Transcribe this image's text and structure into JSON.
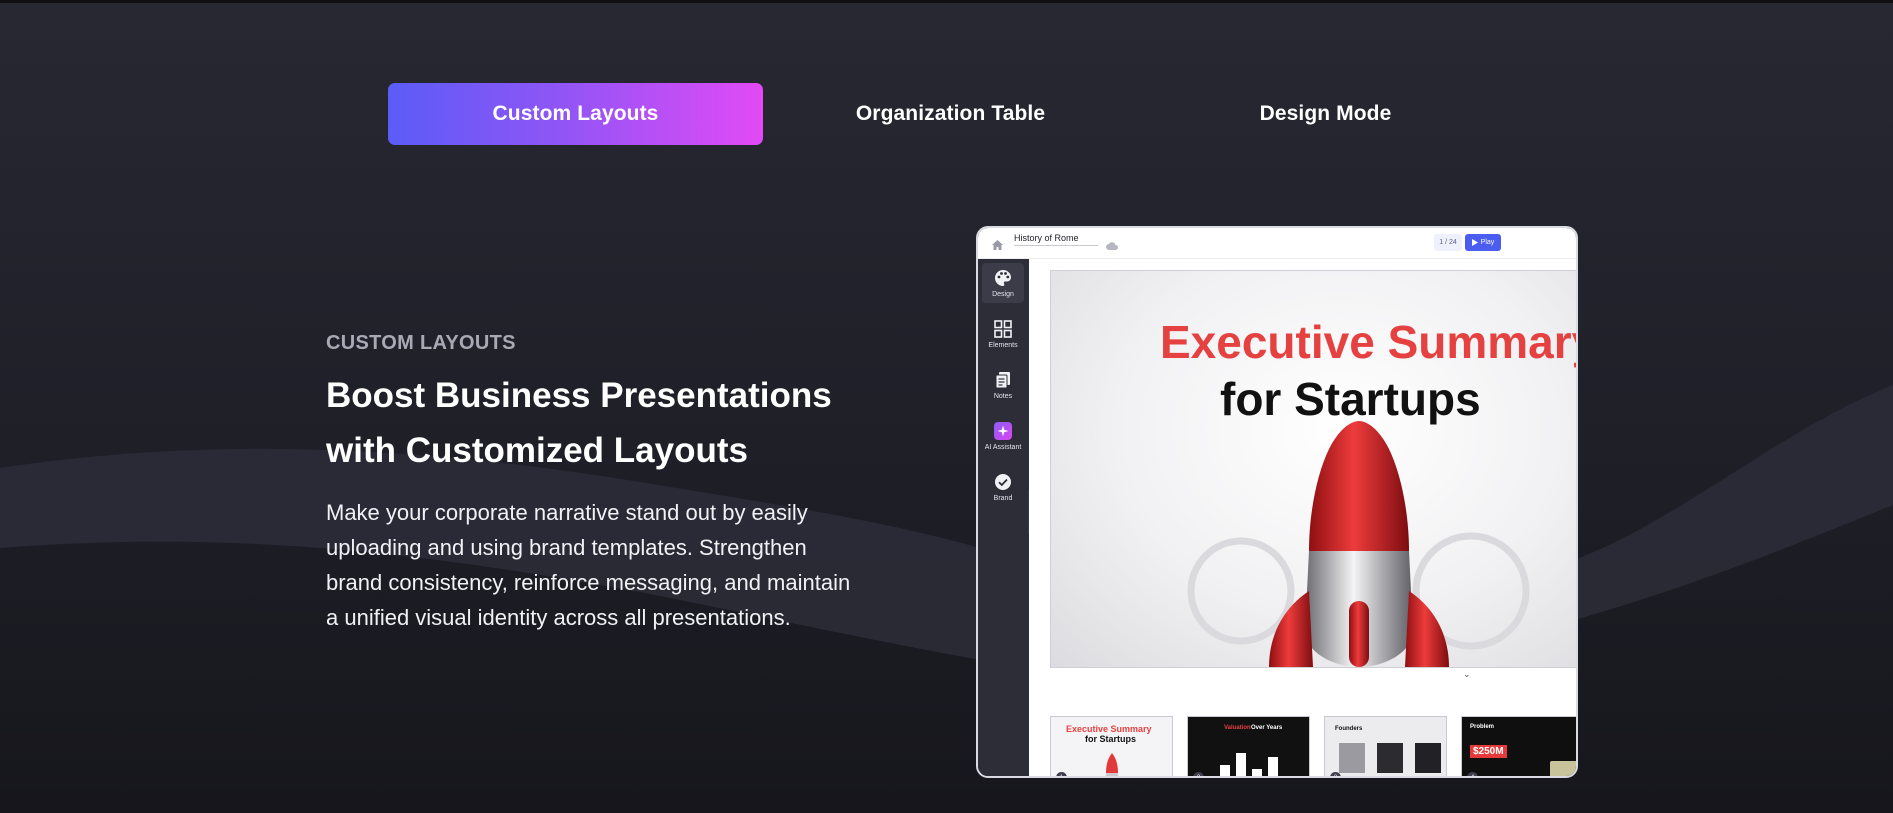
{
  "tabs": [
    {
      "label": "Custom Layouts",
      "active": true
    },
    {
      "label": "Organization Table",
      "active": false
    },
    {
      "label": "Design Mode",
      "active": false
    }
  ],
  "feature": {
    "eyebrow": "CUSTOM LAYOUTS",
    "headline_line1": "Boost Business Presentations",
    "headline_line2": "with Customized Layouts",
    "body": "Make your corporate narrative stand out by easily uploading and using brand templates. Strengthen brand consistency, reinforce messaging, and maintain a unified visual identity across all presentations."
  },
  "preview": {
    "doc_title": "History of Rome",
    "pager": "1 / 24",
    "play_label": "Play",
    "sidebar": [
      {
        "label": "Design",
        "icon": "palette-icon"
      },
      {
        "label": "Elements",
        "icon": "grid-icon"
      },
      {
        "label": "Notes",
        "icon": "notes-icon"
      },
      {
        "label": "AI Assistant",
        "icon": "sparkle-icon"
      },
      {
        "label": "Brand",
        "icon": "badge-check-icon"
      }
    ],
    "slide": {
      "title_line1": "Executive Summary",
      "title_line2": "for Startups"
    },
    "thumbnails": [
      {
        "num": "1",
        "title_red": "Executive Summary",
        "title_black": "for Startups"
      },
      {
        "num": "2",
        "title_red": "Valuation",
        "title_white": "Over Years"
      },
      {
        "num": "3",
        "title": "Founders"
      },
      {
        "num": "4",
        "title": "Problem",
        "value": "$250M"
      }
    ]
  },
  "colors": {
    "background": "#22222b",
    "tab_gradient_start": "#5b5cf7",
    "tab_gradient_end": "#e24af5",
    "slide_red": "#e64141",
    "play_blue": "#4b5cf0"
  }
}
